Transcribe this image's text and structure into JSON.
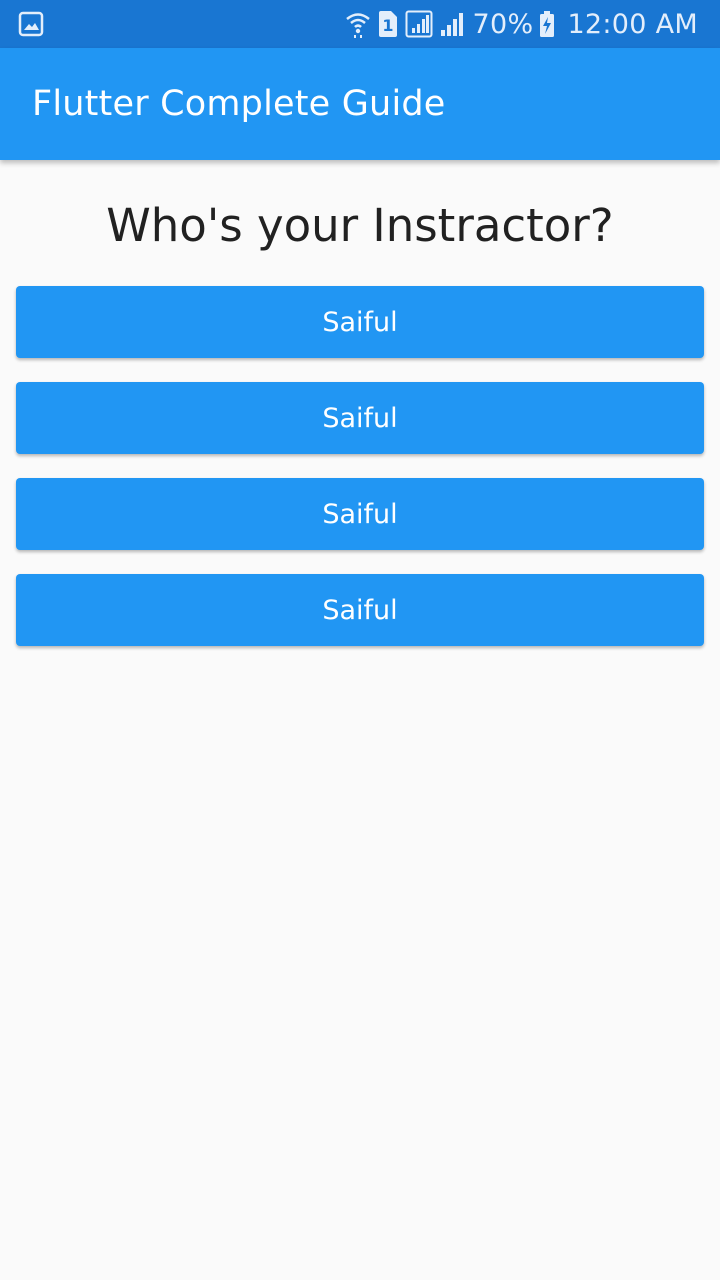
{
  "status_bar": {
    "battery_percent": "70%",
    "time": "12:00 AM",
    "icons": [
      "gallery-icon",
      "wifi-icon",
      "sim-1-icon",
      "signal-boxed-icon",
      "signal-icon",
      "battery-charging-icon"
    ]
  },
  "app_bar": {
    "title": "Flutter Complete Guide",
    "color": "#2196f3"
  },
  "question": {
    "text": "Who's your Instractor?"
  },
  "answers": [
    {
      "label": "Saiful"
    },
    {
      "label": "Saiful"
    },
    {
      "label": "Saiful"
    },
    {
      "label": "Saiful"
    }
  ],
  "colors": {
    "status_bar": "#1976d2",
    "primary": "#2196f3",
    "background": "#fafafa",
    "question_text": "#212121"
  }
}
